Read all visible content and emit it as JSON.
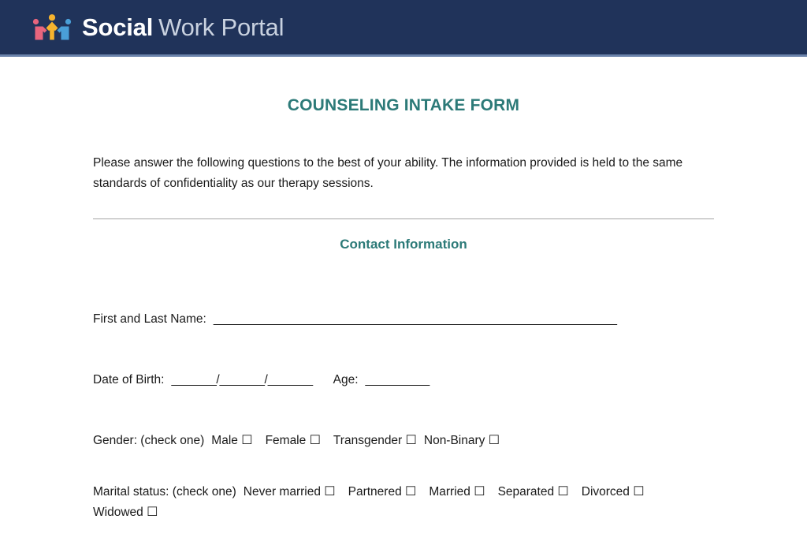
{
  "header": {
    "brand_strong": "Social",
    "brand_light": "Work Portal",
    "logo_icon": "three-people-holding-hands-icon",
    "background_color": "#20335a",
    "accent_line_color": "#6b83ab",
    "logo_colors": {
      "left_figure": "#e8657d",
      "center_figure": "#f5b32e",
      "right_figure": "#4a9fd8"
    }
  },
  "document": {
    "title": "COUNSELING INTAKE FORM",
    "title_color": "#2c7a78",
    "intro": "Please answer the following questions to the best of your ability. The information provided is held to the same standards of confidentiality as our therapy sessions.",
    "section_heading": "Contact Information",
    "divider_color": "#a6a6a6",
    "fields": {
      "name": {
        "label": "First and Last Name:",
        "rule": "_______________________________________________________________"
      },
      "dob": {
        "label": "Date of Birth:",
        "rule_month": "_______",
        "separator": "/",
        "rule_day": "_______",
        "rule_year": "_______",
        "age_label": "Age:",
        "age_rule": "__________"
      },
      "gender": {
        "label": "Gender: (check one)",
        "checkbox_glyph": "☐",
        "options": [
          "Male",
          "Female",
          "Transgender",
          "Non-Binary"
        ]
      },
      "marital": {
        "label": "Marital status: (check one)",
        "checkbox_glyph": "☐",
        "options": [
          "Never married",
          "Partnered",
          "Married",
          "Separated",
          "Divorced",
          "Widowed"
        ]
      }
    }
  }
}
